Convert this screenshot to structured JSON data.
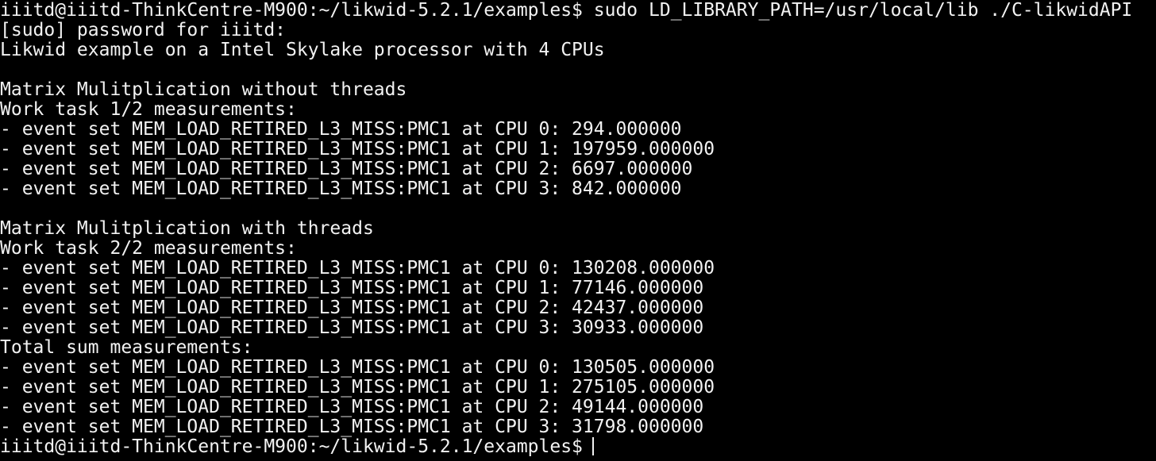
{
  "colors": {
    "background": "#000000",
    "foreground": "#f2f2f2"
  },
  "terminal": {
    "prompt": "iiitd@iiitd-ThinkCentre-M900:~/likwid-5.2.1/examples$",
    "command": "sudo LD_LIBRARY_PATH=/usr/local/lib ./C-likwidAPI",
    "lines": [
      "[sudo] password for iiitd:",
      "Likwid example on a Intel Skylake processor with 4 CPUs",
      "",
      "Matrix Mulitplication without threads",
      "Work task 1/2 measurements:",
      "- event set MEM_LOAD_RETIRED_L3_MISS:PMC1 at CPU 0: 294.000000",
      "- event set MEM_LOAD_RETIRED_L3_MISS:PMC1 at CPU 1: 197959.000000",
      "- event set MEM_LOAD_RETIRED_L3_MISS:PMC1 at CPU 2: 6697.000000",
      "- event set MEM_LOAD_RETIRED_L3_MISS:PMC1 at CPU 3: 842.000000",
      "",
      "Matrix Mulitplication with threads",
      "Work task 2/2 measurements:",
      "- event set MEM_LOAD_RETIRED_L3_MISS:PMC1 at CPU 0: 130208.000000",
      "- event set MEM_LOAD_RETIRED_L3_MISS:PMC1 at CPU 1: 77146.000000",
      "- event set MEM_LOAD_RETIRED_L3_MISS:PMC1 at CPU 2: 42437.000000",
      "- event set MEM_LOAD_RETIRED_L3_MISS:PMC1 at CPU 3: 30933.000000",
      "Total sum measurements:",
      "- event set MEM_LOAD_RETIRED_L3_MISS:PMC1 at CPU 0: 130505.000000",
      "- event set MEM_LOAD_RETIRED_L3_MISS:PMC1 at CPU 1: 275105.000000",
      "- event set MEM_LOAD_RETIRED_L3_MISS:PMC1 at CPU 2: 49144.000000",
      "- event set MEM_LOAD_RETIRED_L3_MISS:PMC1 at CPU 3: 31798.000000"
    ],
    "final_prompt": "iiitd@iiitd-ThinkCentre-M900:~/likwid-5.2.1/examples$"
  }
}
